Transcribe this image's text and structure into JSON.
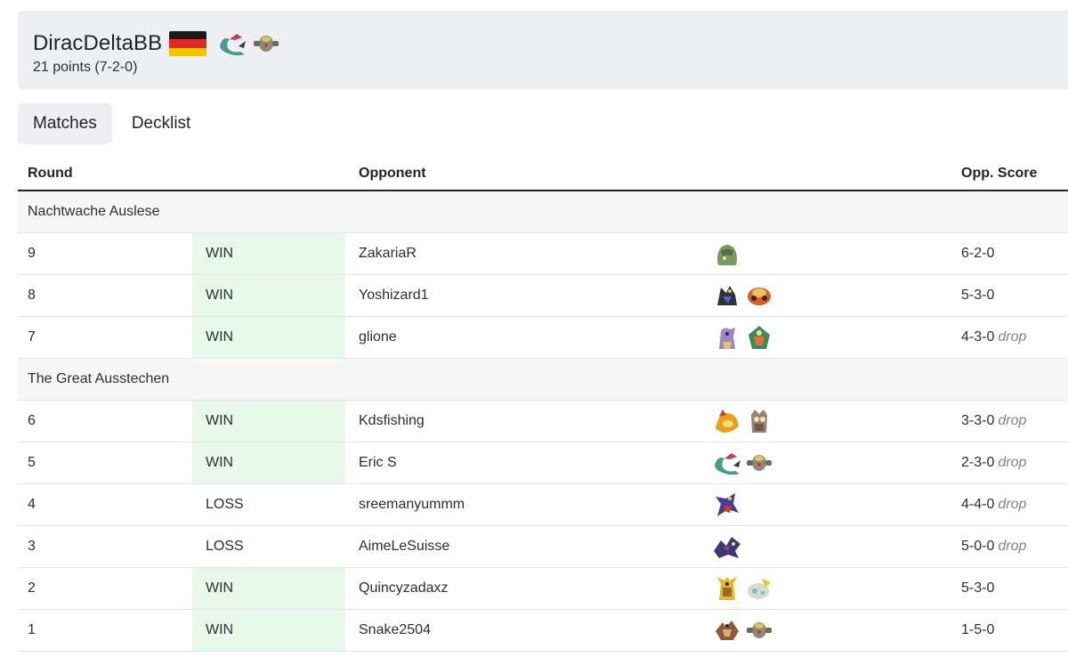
{
  "player": {
    "name": "DiracDeltaBB",
    "record": "21 points (7-2-0)",
    "flag_colors": [
      "#1a1a1a",
      "#dd2a2a",
      "#f2c200"
    ],
    "deck_icons": [
      "dragapult-icon",
      "dusknoir-icon"
    ]
  },
  "tabs": [
    {
      "label": "Matches",
      "active": true
    },
    {
      "label": "Decklist",
      "active": false
    }
  ],
  "table": {
    "headers": {
      "round": "Round",
      "opponent": "Opponent",
      "score": "Opp. Score"
    },
    "sections": [
      {
        "title": "Nachtwache Auslese",
        "rows": [
          {
            "round": "9",
            "result": "WIN",
            "opponent": "ZakariaR",
            "deck": [
              "green-rock-pokemon-icon"
            ],
            "score": "6-2-0",
            "drop": ""
          },
          {
            "round": "8",
            "result": "WIN",
            "opponent": "Yoshizard1",
            "deck": [
              "dark-pokemon-icon",
              "fire-pokemon-icon"
            ],
            "score": "5-3-0",
            "drop": ""
          },
          {
            "round": "7",
            "result": "WIN",
            "opponent": "glione",
            "deck": [
              "purple-pokemon-icon",
              "grass-pokemon-icon"
            ],
            "score": "4-3-0",
            "drop": "drop"
          }
        ]
      },
      {
        "title": "The Great Ausstechen",
        "rows": [
          {
            "round": "6",
            "result": "WIN",
            "opponent": "Kdsfishing",
            "deck": [
              "fire-fox-pokemon-icon",
              "owl-pokemon-icon"
            ],
            "score": "3-3-0",
            "drop": "drop"
          },
          {
            "round": "5",
            "result": "WIN",
            "opponent": "Eric S",
            "deck": [
              "dragapult-icon",
              "dusknoir-icon"
            ],
            "score": "2-3-0",
            "drop": "drop"
          },
          {
            "round": "4",
            "result": "LOSS",
            "opponent": "sreemanyummm",
            "deck": [
              "garchomp-pokemon-icon"
            ],
            "score": "4-4-0",
            "drop": "drop"
          },
          {
            "round": "3",
            "result": "LOSS",
            "opponent": "AimeLeSuisse",
            "deck": [
              "dark-dragon-pokemon-icon"
            ],
            "score": "5-0-0",
            "drop": "drop"
          },
          {
            "round": "2",
            "result": "WIN",
            "opponent": "Quincyzadaxz",
            "deck": [
              "alakazam-pokemon-icon",
              "electric-pokemon-icon"
            ],
            "score": "5-3-0",
            "drop": ""
          },
          {
            "round": "1",
            "result": "WIN",
            "opponent": "Snake2504",
            "deck": [
              "brown-pokemon-icon",
              "dusknoir-icon"
            ],
            "score": "1-5-0",
            "drop": ""
          }
        ]
      }
    ]
  }
}
